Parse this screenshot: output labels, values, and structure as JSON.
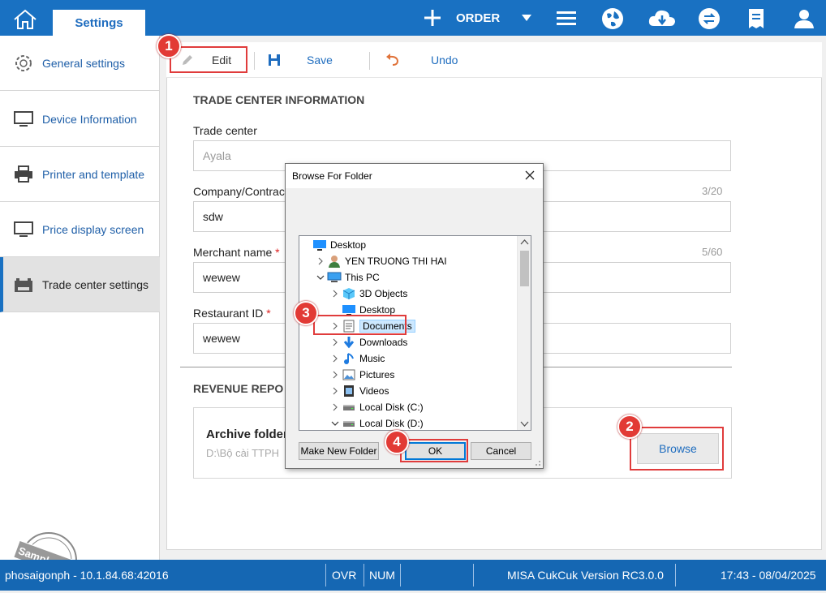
{
  "topbar": {
    "tab_label": "Settings",
    "order_label": "ORDER"
  },
  "sidebar": {
    "items": [
      {
        "label": "General settings"
      },
      {
        "label": "Device Information"
      },
      {
        "label": "Printer and template"
      },
      {
        "label": "Price display screen"
      },
      {
        "label": "Trade center settings"
      }
    ],
    "stamp_text": "Sample Data"
  },
  "toolbar": {
    "edit_label": "Edit",
    "save_label": "Save",
    "undo_label": "Undo"
  },
  "form": {
    "section1_title": "TRADE CENTER INFORMATION",
    "trade_center_label": "Trade center",
    "trade_center_value": "Ayala",
    "company_label": "Company/Contract",
    "company_value": "sdw",
    "company_counter": "3/20",
    "merchant_label": "Merchant name",
    "merchant_value": "wewew",
    "merchant_counter": "5/60",
    "restaurant_label": "Restaurant ID",
    "restaurant_value": "wewew",
    "required_mark": "*",
    "section2_title": "REVENUE REPO",
    "archive_label": "Archive folder",
    "archive_path": "D:\\Bộ cài TTPH",
    "browse_label": "Browse"
  },
  "dialog": {
    "title": "Browse For Folder",
    "tree": [
      {
        "label": "Desktop",
        "level": 0,
        "expander": "",
        "icon": "desktop-icon"
      },
      {
        "label": "YEN TRUONG THI HAI",
        "level": 1,
        "expander": ">",
        "icon": "user-icon"
      },
      {
        "label": "This PC",
        "level": 1,
        "expander": "v",
        "icon": "pc-icon"
      },
      {
        "label": "3D Objects",
        "level": 2,
        "expander": ">",
        "icon": "cube-icon"
      },
      {
        "label": "Desktop",
        "level": 2,
        "expander": "",
        "icon": "desktop-icon"
      },
      {
        "label": "Documents",
        "level": 2,
        "expander": ">",
        "icon": "document-icon",
        "selected": true
      },
      {
        "label": "Downloads",
        "level": 2,
        "expander": ">",
        "icon": "download-icon"
      },
      {
        "label": "Music",
        "level": 2,
        "expander": ">",
        "icon": "music-icon"
      },
      {
        "label": "Pictures",
        "level": 2,
        "expander": ">",
        "icon": "pictures-icon"
      },
      {
        "label": "Videos",
        "level": 2,
        "expander": ">",
        "icon": "video-icon"
      },
      {
        "label": "Local Disk (C:)",
        "level": 2,
        "expander": ">",
        "icon": "disk-icon"
      },
      {
        "label": "Local Disk (D:)",
        "level": 2,
        "expander": "v",
        "icon": "disk-icon"
      }
    ],
    "make_new_folder_label": "Make New Folder",
    "ok_label": "OK",
    "cancel_label": "Cancel"
  },
  "badges": [
    "1",
    "2",
    "3",
    "4"
  ],
  "status": {
    "host": "phosaigonph - 10.1.84.68:42016",
    "ovr": "OVR",
    "num": "NUM",
    "version": "MISA CukCuk Version RC3.0.0",
    "datetime": "17:43 - 08/04/2025"
  },
  "colors": {
    "brand_blue": "#1971c2",
    "badge_red": "#e23a35"
  }
}
